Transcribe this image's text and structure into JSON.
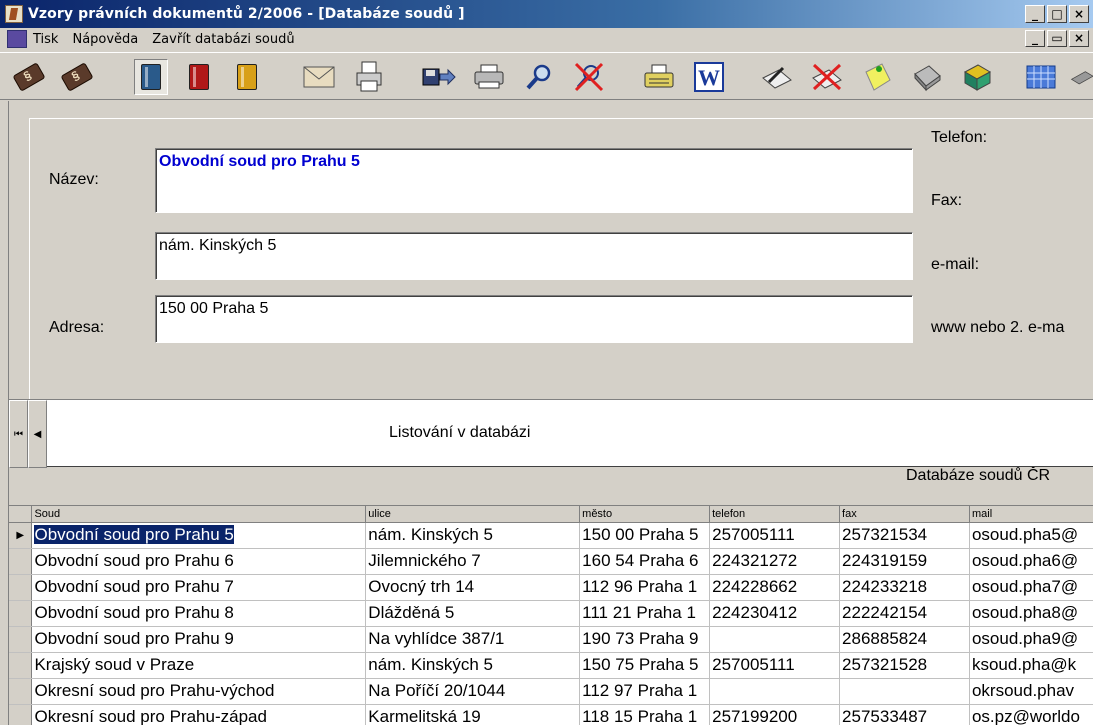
{
  "window": {
    "title": "Vzory právních dokumentů 2/2006 - [Databáze soudů ]",
    "controls": [
      "_",
      "□",
      "×"
    ]
  },
  "menu": {
    "items": [
      "Tisk",
      "Nápověda",
      "Zavřít databázi soudů"
    ],
    "mdi_controls": [
      "_",
      "▭",
      "×"
    ]
  },
  "toolbar": {
    "icons": [
      "law-book-icon",
      "law-book-icon",
      "blue-book-icon",
      "red-book-icon",
      "yellow-book-icon",
      "envelope-icon",
      "page-print-icon",
      "save-arrow-icon",
      "printer-icon",
      "magnifier-icon",
      "cancel-search-icon",
      "typewriter-icon",
      "word-icon",
      "pen-paper-icon",
      "cancel-pen-icon",
      "sticky-note-icon",
      "calculator-icon",
      "green-box-icon",
      "calendar-icon",
      "scanner-icon"
    ]
  },
  "form": {
    "name_label": "Název:",
    "address_label": "Adresa:",
    "name_value": "Obvodní soud pro Prahu 5",
    "street_value": "nám. Kinských 5",
    "city_value": "150 00  Praha 5",
    "phone_label": "Telefon:",
    "fax_label": "Fax:",
    "email_label": "e-mail:",
    "www_label": "www nebo 2. e-ma"
  },
  "navigation": {
    "first": "⏮",
    "prev": "◀",
    "label": "Listování v databázi"
  },
  "db_title": "Databáze soudů ČR",
  "grid": {
    "columns": [
      "Soud",
      "ulice",
      "město",
      "telefon",
      "fax",
      "mail"
    ],
    "rows": [
      [
        "Obvodní soud pro Prahu 5",
        "nám. Kinských 5",
        "150 00  Praha 5",
        "257005111",
        "257321534",
        "osoud.pha5@"
      ],
      [
        "Obvodní soud pro Prahu 6",
        "Jilemnického 7",
        "160 54  Praha 6",
        "224321272",
        "224319159",
        "osoud.pha6@"
      ],
      [
        "Obvodní soud pro Prahu 7",
        "Ovocný trh 14",
        "112 96  Praha 1",
        "224228662",
        "224233218",
        "osoud.pha7@"
      ],
      [
        "Obvodní soud pro Prahu 8",
        "Dlážděná 5",
        "111 21  Praha 1",
        "224230412",
        "222242154",
        "osoud.pha8@"
      ],
      [
        "Obvodní soud pro Prahu 9",
        "Na vyhlídce 387/1",
        "190 73  Praha 9",
        "",
        "286885824",
        "osoud.pha9@"
      ],
      [
        "Krajský soud v Praze",
        "nám. Kinských 5",
        "150 75  Praha 5",
        "257005111",
        "257321528",
        "ksoud.pha@k"
      ],
      [
        "Okresní soud pro Prahu-východ",
        "Na Poříčí 20/1044",
        "112 97  Praha 1",
        "",
        "",
        "okrsoud.phav"
      ],
      [
        "Okresní soud pro Prahu-západ",
        "Karmelitská 19",
        "118 15  Praha 1",
        "257199200",
        "257533487",
        "os.pz@worldo"
      ]
    ],
    "current_row_marker": "▶"
  }
}
